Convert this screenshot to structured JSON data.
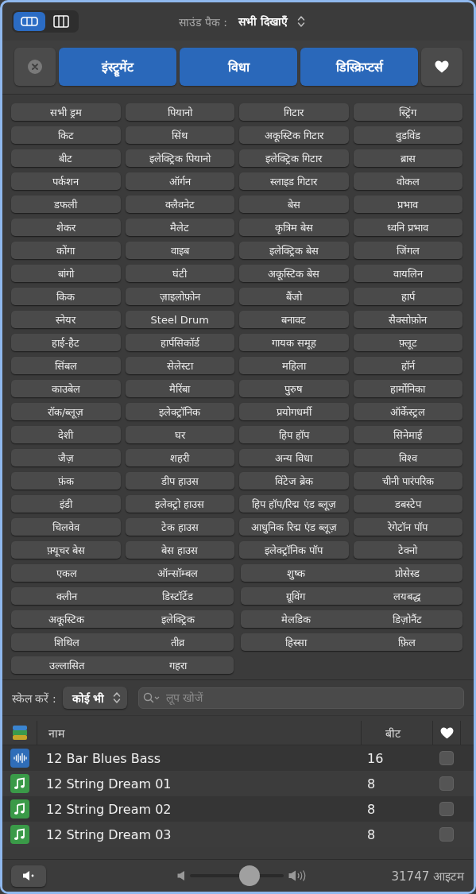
{
  "view_toggle": [
    {
      "kind": "rows",
      "selected": true
    },
    {
      "kind": "columns",
      "selected": false
    }
  ],
  "sound_pack": {
    "label": "साउंड पैक :",
    "value": "सभी दिखाएँ"
  },
  "filter_tabs": [
    {
      "label": "इंस्ट्रूमेंट",
      "selected": true
    },
    {
      "label": "विधा",
      "selected": true
    },
    {
      "label": "डिस्क्रिप्टर्स",
      "selected": true
    }
  ],
  "keywords": [
    {
      "label": "सभी ड्रम",
      "selected": false
    },
    {
      "label": "पियानो",
      "selected": false
    },
    {
      "label": "गिटार",
      "selected": false
    },
    {
      "label": "स्ट्रिंग",
      "selected": false
    },
    {
      "label": "किट",
      "selected": false
    },
    {
      "label": "सिंथ",
      "selected": false
    },
    {
      "label": "अकूस्टिक गिटार",
      "selected": false
    },
    {
      "label": "वुडविंड",
      "selected": false
    },
    {
      "label": "बीट",
      "selected": false
    },
    {
      "label": "इलेक्ट्रिक पियानो",
      "selected": false
    },
    {
      "label": "इलेक्ट्रिक गिटार",
      "selected": false
    },
    {
      "label": "ब्रास",
      "selected": false
    },
    {
      "label": "पर्कशन",
      "selected": false
    },
    {
      "label": "ऑर्गन",
      "selected": false
    },
    {
      "label": "स्लाइड गिटार",
      "selected": false
    },
    {
      "label": "वोकल",
      "selected": false
    },
    {
      "label": "डफली",
      "selected": false
    },
    {
      "label": "क्लैवनेट",
      "selected": false
    },
    {
      "label": "बेस",
      "selected": false
    },
    {
      "label": "प्रभाव",
      "selected": false
    },
    {
      "label": "शेकर",
      "selected": false
    },
    {
      "label": "मैलेट",
      "selected": false
    },
    {
      "label": "कृत्रिम बेस",
      "selected": false
    },
    {
      "label": "ध्वनि प्रभाव",
      "selected": false
    },
    {
      "label": "कोंगा",
      "selected": false
    },
    {
      "label": "वाइब",
      "selected": false
    },
    {
      "label": "इलेक्ट्रिक बेस",
      "selected": false
    },
    {
      "label": "जिंगल",
      "selected": false
    },
    {
      "label": "बांगो",
      "selected": false
    },
    {
      "label": "घंटी",
      "selected": false
    },
    {
      "label": "अकूस्टिक बेस",
      "selected": false
    },
    {
      "label": "वायलिन",
      "selected": false
    },
    {
      "label": "किक",
      "selected": false
    },
    {
      "label": "ज़ाइलोफ़ोन",
      "selected": false
    },
    {
      "label": "बैंजो",
      "selected": false
    },
    {
      "label": "हार्प",
      "selected": false
    },
    {
      "label": "स्नेयर",
      "selected": false
    },
    {
      "label": "Steel Drum",
      "selected": false
    },
    {
      "label": "बनावट",
      "selected": false
    },
    {
      "label": "सैक्सोफ़ोन",
      "selected": false
    },
    {
      "label": "हाई-हैट",
      "selected": false
    },
    {
      "label": "हार्पसिकॉर्ड",
      "selected": false
    },
    {
      "label": "गायक समूह",
      "selected": false
    },
    {
      "label": "फ़्लूट",
      "selected": false
    },
    {
      "label": "सिंबल",
      "selected": false
    },
    {
      "label": "सेलेस्टा",
      "selected": false
    },
    {
      "label": "महिला",
      "selected": false
    },
    {
      "label": "हॉर्न",
      "selected": false
    },
    {
      "label": "काउबेल",
      "selected": false
    },
    {
      "label": "मैरिंबा",
      "selected": false
    },
    {
      "label": "पुरुष",
      "selected": false
    },
    {
      "label": "हार्मोनिका",
      "selected": false
    },
    {
      "label": "रॉक/ब्लूज़",
      "selected": false
    },
    {
      "label": "इलेक्ट्रॉनिक",
      "selected": false
    },
    {
      "label": "प्रयोगधर्मी",
      "selected": false
    },
    {
      "label": "ऑर्केस्ट्रल",
      "selected": false
    },
    {
      "label": "देशी",
      "selected": false
    },
    {
      "label": "घर",
      "selected": false
    },
    {
      "label": "हिप हॉप",
      "selected": false
    },
    {
      "label": "सिनेमाई",
      "selected": false
    },
    {
      "label": "जैज़",
      "selected": false
    },
    {
      "label": "शहरी",
      "selected": false
    },
    {
      "label": "अन्य विधा",
      "selected": false
    },
    {
      "label": "विश्व",
      "selected": false
    },
    {
      "label": "फ़ंक",
      "selected": false
    },
    {
      "label": "डीप हाउस",
      "selected": false
    },
    {
      "label": "विंटेज ब्रेक",
      "selected": false
    },
    {
      "label": "चीनी पारंपरिक",
      "selected": false
    },
    {
      "label": "इंडी",
      "selected": false
    },
    {
      "label": "इलेक्ट्रो हाउस",
      "selected": false
    },
    {
      "label": "हिप हॉप/रिद्म एंड ब्लूज़",
      "selected": false
    },
    {
      "label": "डबस्टेप",
      "selected": false
    },
    {
      "label": "चिलवेव",
      "selected": false
    },
    {
      "label": "टेक हाउस",
      "selected": false
    },
    {
      "label": "आधुनिक रिद्म एंड ब्लूज़",
      "selected": false
    },
    {
      "label": "रेगेटॉन पॉप",
      "selected": false
    },
    {
      "label": "फ़्यूचर बेस",
      "selected": false
    },
    {
      "label": "बेस हाउस",
      "selected": false
    },
    {
      "label": "इलेक्ट्रॉनिक पॉप",
      "selected": false
    },
    {
      "label": "टेक्नो",
      "selected": false
    }
  ],
  "descriptors": [
    {
      "left": {
        "label": "एकल",
        "selected": false
      },
      "right": {
        "label": "ऑन्सॉम्बल",
        "selected": false
      }
    },
    {
      "left": {
        "label": "शुष्क",
        "selected": false
      },
      "right": {
        "label": "प्रोसेस्ड",
        "selected": false
      }
    },
    {
      "left": {
        "label": "क्लीन",
        "selected": false
      },
      "right": {
        "label": "डिस्टॉर्टेड",
        "selected": false
      }
    },
    {
      "left": {
        "label": "ग्रूविंग",
        "selected": false
      },
      "right": {
        "label": "लयबद्ध",
        "selected": false
      }
    },
    {
      "left": {
        "label": "अकूस्टिक",
        "selected": false
      },
      "right": {
        "label": "इलेक्ट्रिक",
        "selected": false
      }
    },
    {
      "left": {
        "label": "मेलडिक",
        "selected": false
      },
      "right": {
        "label": "डिज़ोनैंट",
        "selected": false
      }
    },
    {
      "left": {
        "label": "शिथिल",
        "selected": false
      },
      "right": {
        "label": "तीव्र",
        "selected": false
      }
    },
    {
      "left": {
        "label": "हिस्सा",
        "selected": false
      },
      "right": {
        "label": "फ़िल",
        "selected": false
      }
    },
    {
      "left": {
        "label": "उल्लासित",
        "selected": false
      },
      "right": {
        "label": "गहरा",
        "selected": false
      }
    }
  ],
  "scale": {
    "label": "स्केल करें :",
    "value": "कोई भी"
  },
  "search": {
    "placeholder": "लूप खोजें"
  },
  "table": {
    "columns": {
      "name": "नाम",
      "beats": "बीट"
    },
    "rows": [
      {
        "kind": "audio",
        "name": "12 Bar Blues Bass",
        "beats": "16",
        "favorite": false
      },
      {
        "kind": "instrument",
        "name": "12 String Dream 01",
        "beats": "8",
        "favorite": false
      },
      {
        "kind": "instrument",
        "name": "12 String Dream 02",
        "beats": "8",
        "favorite": false
      },
      {
        "kind": "instrument",
        "name": "12 String Dream 03",
        "beats": "8",
        "favorite": false
      }
    ]
  },
  "footer": {
    "volume": {
      "level": 0.63
    },
    "count": "31747 आइटम"
  }
}
